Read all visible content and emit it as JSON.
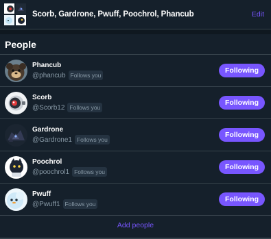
{
  "header": {
    "title": "Scorb, Gardrone, Pwuff, Poochrol, Phancub",
    "edit_label": "Edit"
  },
  "section": {
    "title": "People"
  },
  "people": [
    {
      "name": "Phancub",
      "handle": "@phancub",
      "badge": "Follows you",
      "button": "Following",
      "avatar": "phancub-avatar"
    },
    {
      "name": "Scorb",
      "handle": "@Scorb12",
      "badge": "Follows you",
      "button": "Following",
      "avatar": "scorb-avatar"
    },
    {
      "name": "Gardrone",
      "handle": "@Gardrone1",
      "badge": "Follows you",
      "button": "Following",
      "avatar": "gardrone-avatar"
    },
    {
      "name": "Poochrol",
      "handle": "@poochrol1",
      "badge": "Follows you",
      "button": "Following",
      "avatar": "poochrol-avatar"
    },
    {
      "name": "Pwuff",
      "handle": "@Pwuff1",
      "badge": "Follows you",
      "button": "Following",
      "avatar": "pwuff-avatar"
    }
  ],
  "add_people_label": "Add people",
  "colors": {
    "background": "#15202b",
    "accent": "#7856ff",
    "border": "#38444d",
    "muted": "#8899a6"
  }
}
